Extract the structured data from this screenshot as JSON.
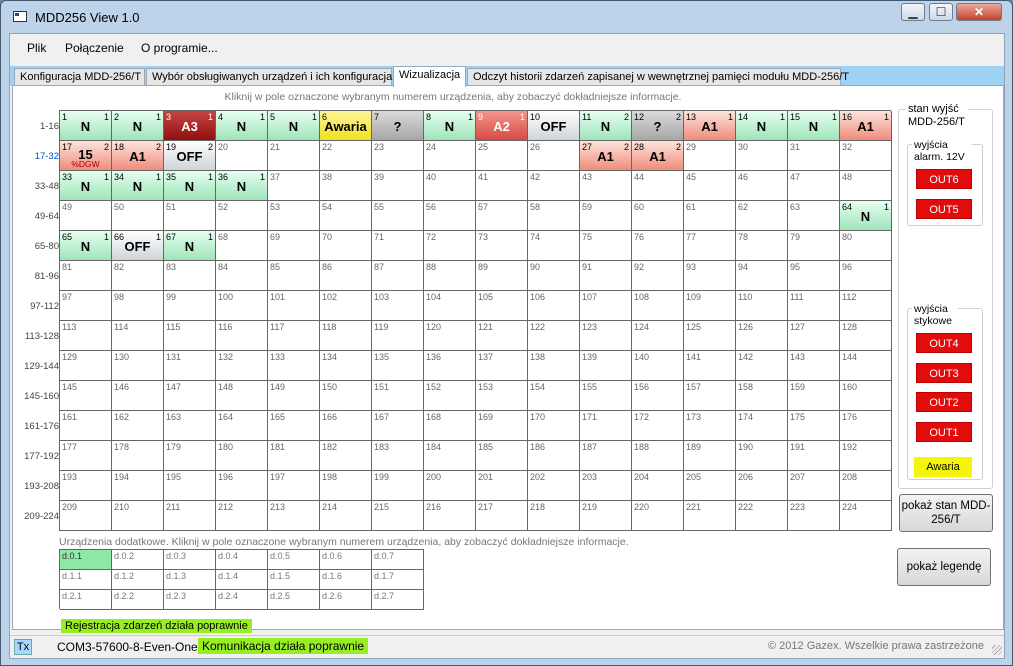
{
  "window": {
    "title": "MDD256 View 1.0",
    "minimize": "▁",
    "maximize": "☐",
    "close": "✕"
  },
  "menu": [
    "Plik",
    "Połączenie",
    "O programie..."
  ],
  "tabs": [
    "Konfiguracja MDD-256/T",
    "Wybór obsługiwanych urządzeń i ich konfiguracja",
    "Wizualizacja",
    "Odczyt historii zdarzeń zapisanej w wewnętrznej pamięci modułu MDD-256/T"
  ],
  "active_tab": 2,
  "hint_main": "Kliknij w pole oznaczone wybranym numerem urządzenia, aby zobaczyć dokładniejsze informacje.",
  "row_labels": [
    "1-16",
    "17-32",
    "33-48",
    "49-64",
    "65-80",
    "81-96",
    "97-112",
    "113-128",
    "129-144",
    "145-160",
    "161-176",
    "177-192",
    "193-208",
    "209-224"
  ],
  "highlight_row_label": 1,
  "device_count": 224,
  "devices": {
    "1": {
      "state": "N",
      "label": "N",
      "sub": "1"
    },
    "2": {
      "state": "N",
      "label": "N",
      "sub": "1"
    },
    "3": {
      "state": "A3",
      "label": "A3",
      "sub": "1"
    },
    "4": {
      "state": "N",
      "label": "N",
      "sub": "1"
    },
    "5": {
      "state": "N",
      "label": "N",
      "sub": "1"
    },
    "6": {
      "state": "AW",
      "label": "Awaria",
      "sub": ""
    },
    "7": {
      "state": "Q",
      "label": "?",
      "sub": ""
    },
    "8": {
      "state": "N",
      "label": "N",
      "sub": "1"
    },
    "9": {
      "state": "A2",
      "label": "A2",
      "sub": "1"
    },
    "10": {
      "state": "OFF",
      "label": "OFF",
      "sub": ""
    },
    "11": {
      "state": "N",
      "label": "N",
      "sub": "2"
    },
    "12": {
      "state": "Q",
      "label": "?",
      "sub": "2"
    },
    "13": {
      "state": "A1",
      "label": "A1",
      "sub": "1"
    },
    "14": {
      "state": "N",
      "label": "N",
      "sub": "1"
    },
    "15": {
      "state": "N",
      "label": "N",
      "sub": "1"
    },
    "16": {
      "state": "A1",
      "label": "A1",
      "sub": "1"
    },
    "17": {
      "state": "A1",
      "label": "15",
      "sub": "2",
      "small": "%DGW"
    },
    "18": {
      "state": "A1",
      "label": "A1",
      "sub": "2"
    },
    "19": {
      "state": "OFF",
      "label": "OFF",
      "sub": "2"
    },
    "27": {
      "state": "A1",
      "label": "A1",
      "sub": "2"
    },
    "28": {
      "state": "A1",
      "label": "A1",
      "sub": "2"
    },
    "33": {
      "state": "N",
      "label": "N",
      "sub": "1"
    },
    "34": {
      "state": "N",
      "label": "N",
      "sub": "1"
    },
    "35": {
      "state": "N",
      "label": "N",
      "sub": "1"
    },
    "36": {
      "state": "N",
      "label": "N",
      "sub": "1"
    },
    "64": {
      "state": "N",
      "label": "N",
      "sub": "1"
    },
    "65": {
      "state": "N",
      "label": "N",
      "sub": "1"
    },
    "66": {
      "state": "OFF",
      "label": "OFF",
      "sub": "1"
    },
    "67": {
      "state": "N",
      "label": "N",
      "sub": "1"
    }
  },
  "hint_extra": "Urządzenia dodatkowe. Kliknij w pole oznaczone wybranym numerem urządzenia, aby zobaczyć dokładniejsze informacje.",
  "extra_devices": [
    [
      "d.0.1",
      "d.0.2",
      "d.0.3",
      "d.0.4",
      "d.0.5",
      "d.0.6",
      "d.0.7"
    ],
    [
      "d.1.1",
      "d.1.2",
      "d.1.3",
      "d.1.4",
      "d.1.5",
      "d.1.6",
      "d.1.7"
    ],
    [
      "d.2.1",
      "d.2.2",
      "d.2.3",
      "d.2.4",
      "d.2.5",
      "d.2.6",
      "d.2.7"
    ]
  ],
  "extra_active": [
    "d.0.1"
  ],
  "registration_status": "Rejestracja zdarzeń działa poprawnie",
  "side": {
    "title": "stan wyjść MDD-256/T",
    "alarm_group_title": "wyjścia alarm. 12V",
    "alarm_outputs": [
      "OUT6",
      "OUT5"
    ],
    "relay_group_title": "wyjścia stykowe",
    "relay_outputs": [
      "OUT4",
      "OUT3",
      "OUT2",
      "OUT1"
    ],
    "fault_label": "Awaria",
    "show_state_button": "pokaż stan MDD-256/T",
    "show_legend_button": "pokaż legendę"
  },
  "status": {
    "tx": "Tx",
    "port": "COM3-57600-8-Even-One",
    "comm": "Komunikacja działa poprawnie",
    "copyright": "© 2012 Gazex. Wszelkie prawa zastrzeżone"
  },
  "colors": {
    "normal": "#9ee4b9",
    "a1": "#ee8c7c",
    "a2": "#d94945",
    "a3": "#930f0f",
    "off": "#cfd4d8",
    "unknown": "#a6a6a6",
    "fault": "#f1e01f",
    "output_red": "#e20c0c",
    "ok_green": "#97ee22",
    "tabstrip": "#9fd1f5"
  }
}
